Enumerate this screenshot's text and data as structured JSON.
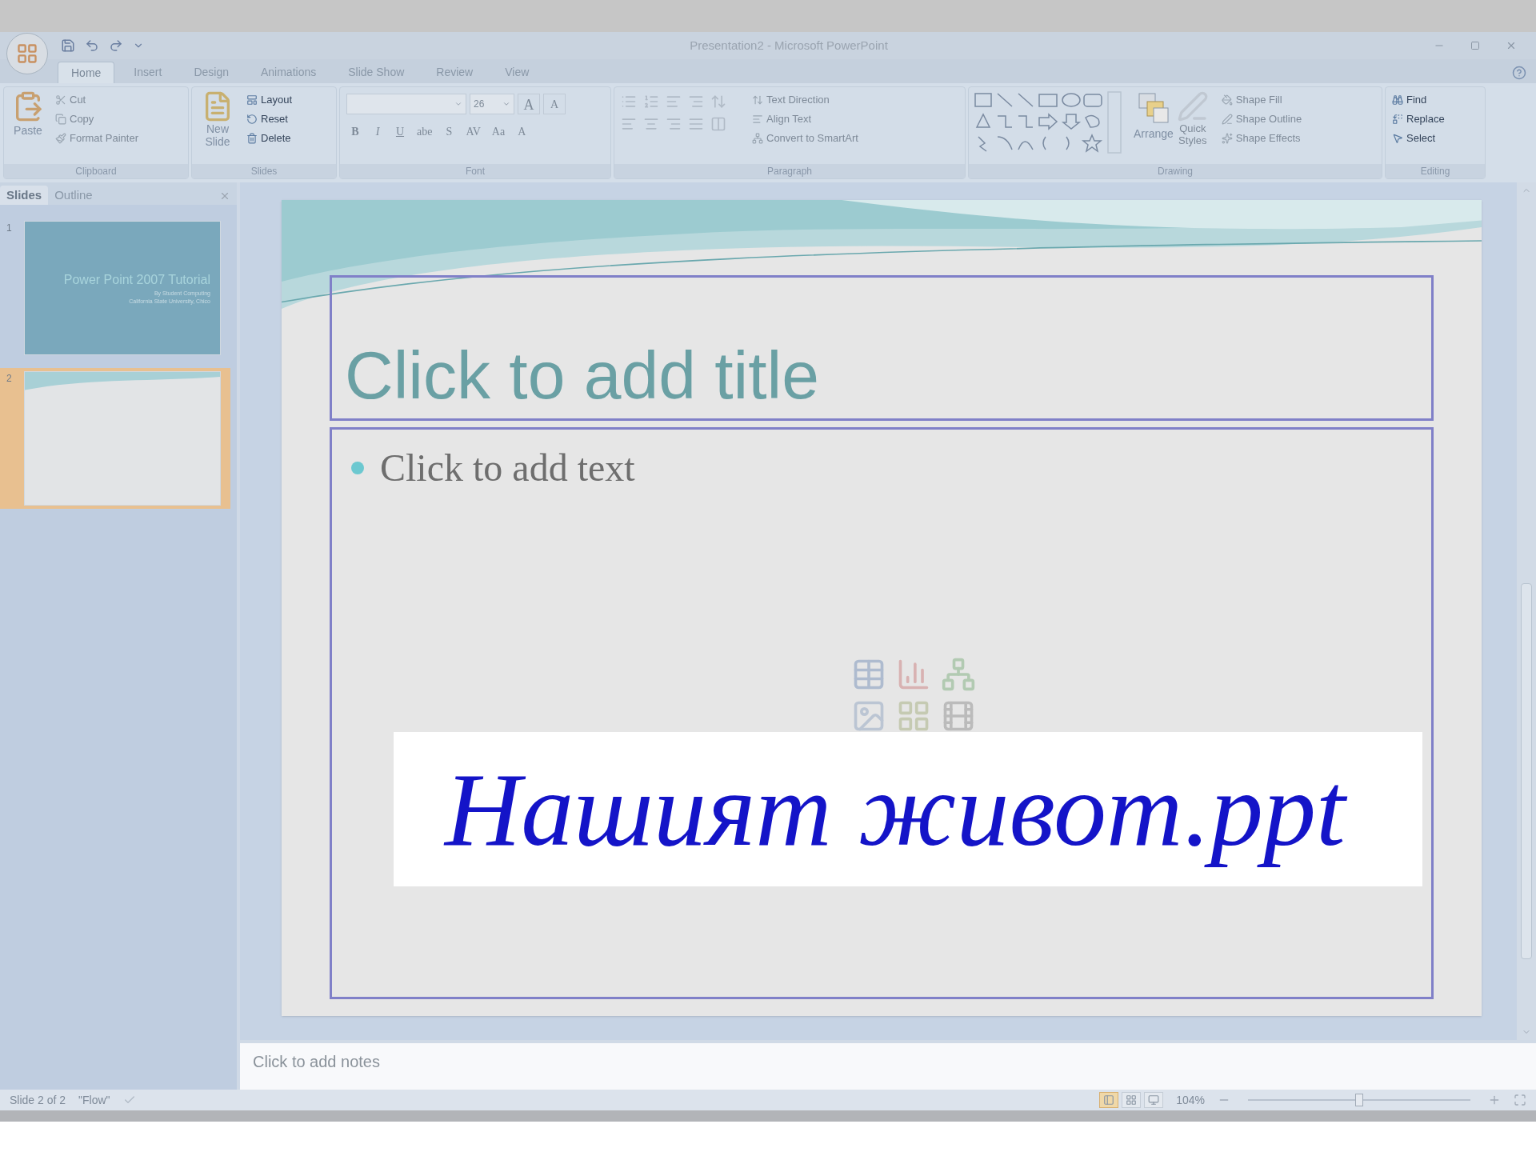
{
  "window": {
    "title": "Presentation2 - Microsoft PowerPoint"
  },
  "tabs": [
    {
      "label": "Home",
      "selected": true
    },
    {
      "label": "Insert",
      "selected": false
    },
    {
      "label": "Design",
      "selected": false
    },
    {
      "label": "Animations",
      "selected": false
    },
    {
      "label": "Slide Show",
      "selected": false
    },
    {
      "label": "Review",
      "selected": false
    },
    {
      "label": "View",
      "selected": false
    }
  ],
  "ribbon": {
    "clipboard": {
      "label": "Clipboard",
      "paste": "Paste",
      "items": [
        {
          "kind": "cut",
          "label": "Cut",
          "disabled": true
        },
        {
          "kind": "copy",
          "label": "Copy",
          "disabled": true
        },
        {
          "kind": "painter",
          "label": "Format Painter",
          "disabled": true
        }
      ]
    },
    "slides": {
      "label": "Slides",
      "new_slide": [
        "New",
        "Slide"
      ],
      "items": [
        {
          "kind": "layout",
          "label": "Layout",
          "disabled": false
        },
        {
          "kind": "reset",
          "label": "Reset",
          "disabled": false
        },
        {
          "kind": "delete",
          "label": "Delete",
          "disabled": false
        }
      ]
    },
    "font": {
      "label": "Font",
      "size": "26",
      "grow": [
        "A",
        "A"
      ],
      "buttons": [
        "B",
        "I",
        "U",
        "abe",
        "S",
        "AV",
        "Aa",
        "A"
      ]
    },
    "paragraph": {
      "label": "Paragraph",
      "items": [
        {
          "kind": "direction",
          "label": "Text Direction",
          "disabled": true
        },
        {
          "kind": "align",
          "label": "Align Text",
          "disabled": true
        },
        {
          "kind": "smartart",
          "label": "Convert to SmartArt",
          "disabled": true
        }
      ]
    },
    "drawing": {
      "label": "Drawing",
      "arrange": "Arrange",
      "quick_styles": [
        "Quick",
        "Styles"
      ],
      "items": [
        {
          "kind": "fill",
          "label": "Shape Fill",
          "disabled": true
        },
        {
          "kind": "outline",
          "label": "Shape Outline",
          "disabled": true
        },
        {
          "kind": "effects",
          "label": "Shape Effects",
          "disabled": true
        }
      ]
    },
    "editing": {
      "label": "Editing",
      "items": [
        {
          "kind": "find",
          "label": "Find",
          "disabled": false
        },
        {
          "kind": "replace",
          "label": "Replace",
          "disabled": false
        },
        {
          "kind": "select",
          "label": "Select",
          "disabled": false
        }
      ]
    }
  },
  "slide_pane": {
    "tabs": [
      {
        "label": "Slides",
        "selected": true
      },
      {
        "label": "Outline",
        "selected": false
      }
    ],
    "thumbnails": [
      {
        "number": "1",
        "kind": "title",
        "selected": false,
        "title": "Power Point 2007 Tutorial",
        "lines": [
          "By Student Computing",
          "California State University, Chico"
        ]
      },
      {
        "number": "2",
        "kind": "blank",
        "selected": true
      }
    ]
  },
  "slide": {
    "title_placeholder": "Click to add title",
    "body_placeholder": "Click to add text",
    "overlay": "Нашият живот.ppt"
  },
  "notes": {
    "placeholder": "Click to add notes"
  },
  "status_bar": {
    "slide": "Slide 2 of 2",
    "theme": "\"Flow\"",
    "views": [
      {
        "kind": "normal",
        "selected": true
      },
      {
        "kind": "sorter",
        "selected": false
      },
      {
        "kind": "show",
        "selected": false
      }
    ],
    "zoom": "104%",
    "zoom_slider": {
      "level": 0.5
    }
  }
}
